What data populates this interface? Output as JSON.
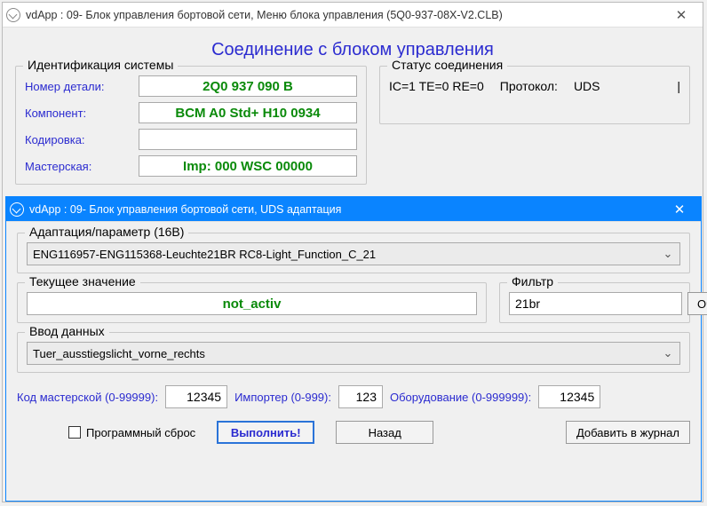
{
  "back": {
    "title": "vdApp : 09- Блок управления бортовой сети,  Меню блока управления (5Q0-937-08X-V2.CLB)",
    "headline": "Соединение с блоком управления",
    "ident_legend": "Идентификация системы",
    "labels": {
      "part": "Номер детали:",
      "component": "Компонент:",
      "coding": "Кодировка:",
      "workshop": "Мастерская:"
    },
    "values": {
      "part": "2Q0 937 090 B",
      "component": "BCM A0 Std+   H10 0934",
      "coding": "",
      "workshop": "Imp: 000    WSC 00000"
    },
    "status": {
      "legend": "Статус соединения",
      "ic": "IC=1  TE=0   RE=0",
      "protocol_label": "Протокол:",
      "protocol_value": "UDS",
      "trailing": "|"
    }
  },
  "front": {
    "title": "vdApp : 09- Блок управления бортовой сети,  UDS адаптация",
    "adaptation_legend": "Адаптация/параметр (16B)",
    "adaptation_value": "ENG116957-ENG115368-Leuchte21BR RC8-Light_Function_C_21",
    "current_legend": "Текущее значение",
    "current_value": "not_activ",
    "filter_legend": "Фильтр",
    "filter_value": "21br",
    "clear_btn": "Очистить",
    "input_legend": "Ввод данных",
    "input_value": "Tuer_ausstiegslicht_vorne_rechts",
    "ws": {
      "code_label": "Код мастерской (0-99999):",
      "code_value": "12345",
      "imp_label": "Импортер (0-999):",
      "imp_value": "123",
      "equip_label": "Оборудование (0-999999):",
      "equip_value": "12345"
    },
    "checkbox_label": "Программный сброс",
    "execute_btn": "Выполнить!",
    "back_btn": "Назад",
    "log_btn": "Добавить в журнал"
  }
}
